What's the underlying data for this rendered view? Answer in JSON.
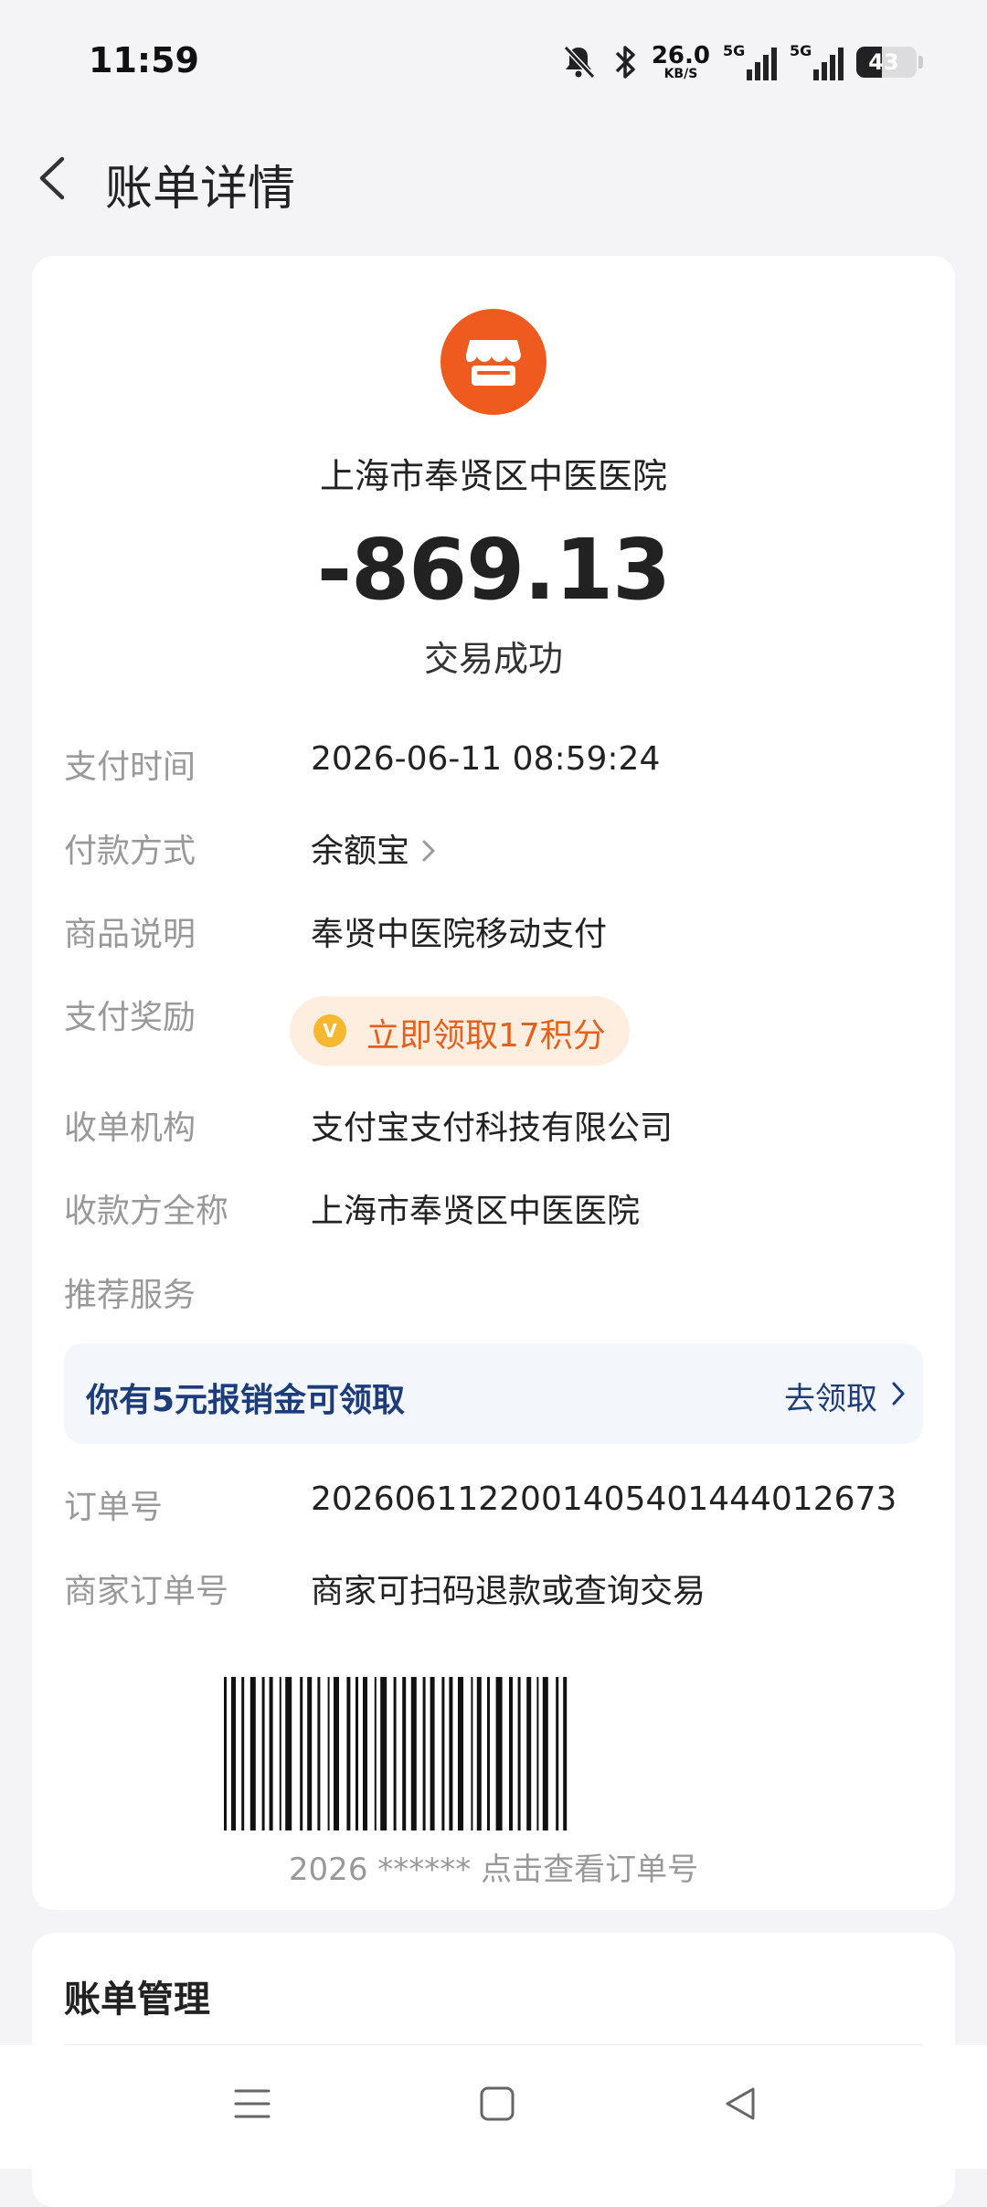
{
  "status_bar": {
    "time": "11:59",
    "net_speed": "26.0",
    "net_speed_unit": "KB/S",
    "signal_1_tag": "5G",
    "signal_2_tag": "5G",
    "battery": "43",
    "battery_level_percent": 43
  },
  "header": {
    "title": "账单详情"
  },
  "bill": {
    "merchant_name": "上海市奉贤区中医医院",
    "amount": "-869.13",
    "status": "交易成功",
    "rows": [
      {
        "label": "支付时间",
        "value": "2026-06-11 08:59:24"
      },
      {
        "label": "付款方式",
        "value": "余额宝"
      },
      {
        "label": "商品说明",
        "value": "奉贤中医院移动支付"
      },
      {
        "label": "支付奖励",
        "value": "立即领取17积分"
      },
      {
        "label": "收单机构",
        "value": "支付宝支付科技有限公司"
      },
      {
        "label": "收款方全称",
        "value": "上海市奉贤区中医医院"
      },
      {
        "label": "推荐服务",
        "value": ""
      },
      {
        "label": "订单号",
        "value": "2026061122001405401444012673"
      },
      {
        "label": "商家订单号",
        "value": "商家可扫码退款或查询交易"
      }
    ],
    "reward_coin_glyph": "V",
    "promo": {
      "text": "你有5元报销金可领取",
      "action": "去领取"
    },
    "barcode_caption": "2026 ****** 点击查看订单号"
  },
  "manage": {
    "title": "账单管理"
  },
  "colors": {
    "accent_orange": "#ef5a1f",
    "reward_text": "#e5601c",
    "promo_blue": "#1c3c7a",
    "label_gray": "#999999"
  }
}
